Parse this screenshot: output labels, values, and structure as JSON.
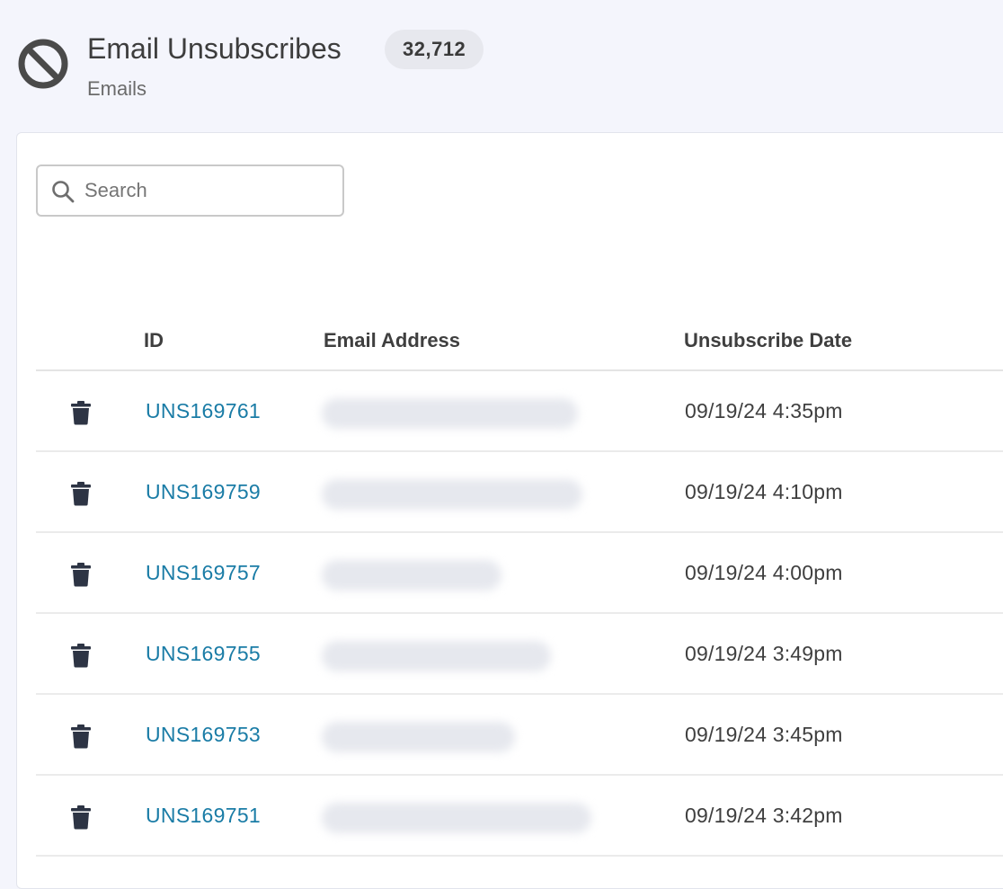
{
  "header": {
    "icon": "block-icon",
    "title": "Email Unsubscribes",
    "count": "32,712",
    "subtitle": "Emails"
  },
  "search": {
    "placeholder": "Search",
    "value": ""
  },
  "table": {
    "columns": [
      "ID",
      "Email Address",
      "Unsubscribe Date"
    ],
    "rows": [
      {
        "id": "UNS169761",
        "date": "09/19/24 4:35pm"
      },
      {
        "id": "UNS169759",
        "date": "09/19/24 4:10pm"
      },
      {
        "id": "UNS169757",
        "date": "09/19/24 4:00pm"
      },
      {
        "id": "UNS169755",
        "date": "09/19/24 3:49pm"
      },
      {
        "id": "UNS169753",
        "date": "09/19/24 3:45pm"
      },
      {
        "id": "UNS169751",
        "date": "09/19/24 3:42pm"
      }
    ]
  },
  "colors": {
    "link": "#1a7ca6",
    "background": "#f4f5fc",
    "badge": "#e7e8ee",
    "icon": "#2d3444"
  }
}
